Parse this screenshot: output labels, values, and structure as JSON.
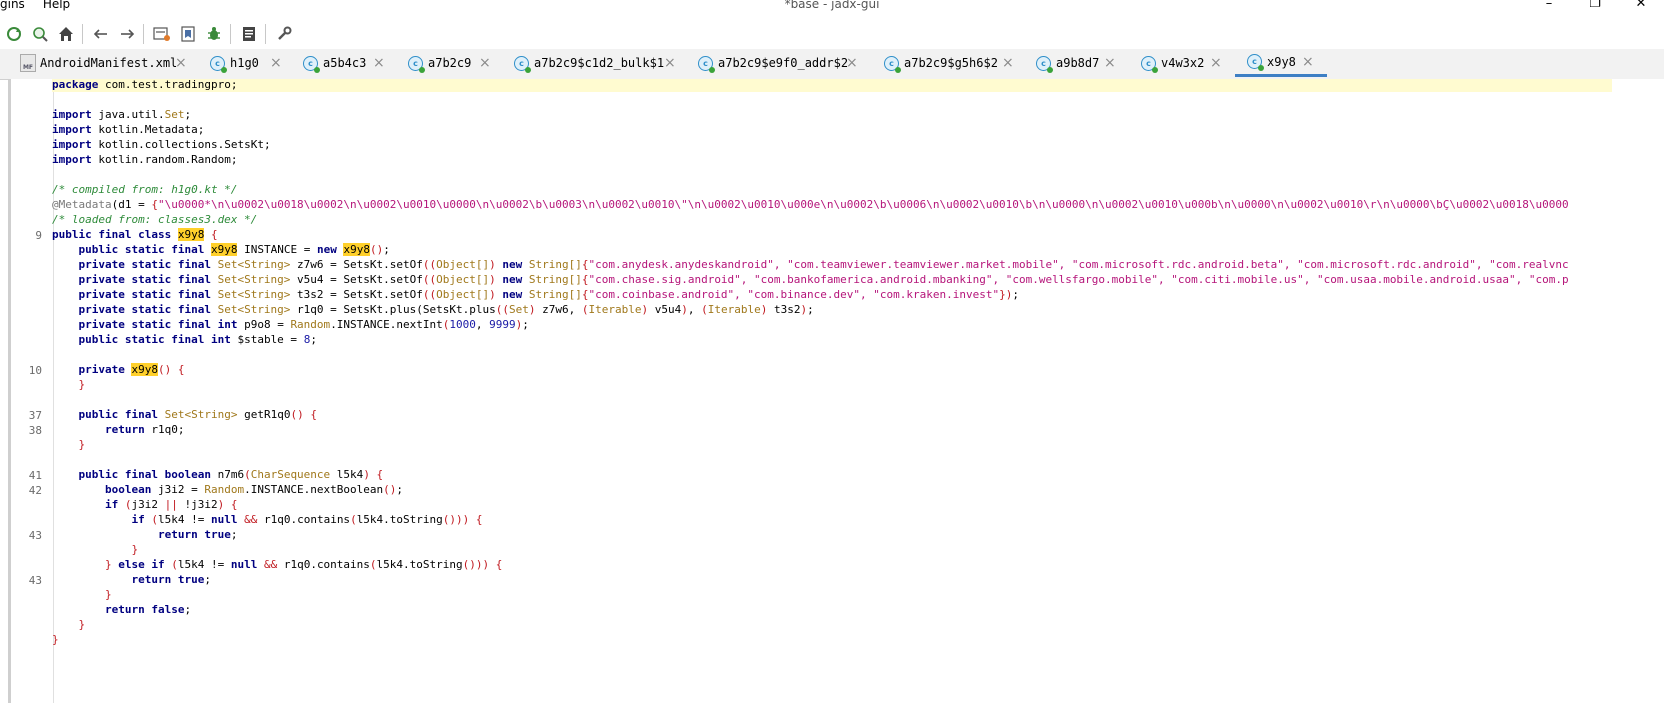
{
  "menu": [
    "gins",
    "Help"
  ],
  "window_title": "*base - jadx-gui",
  "window_controls": [
    "–",
    "❐",
    "✕"
  ],
  "toolbar_icons": [
    "sync-icon",
    "search-icon",
    "home-icon",
    "back-icon",
    "forward-icon",
    "decompile-icon",
    "bookmark-icon",
    "debug-bug-icon",
    "log-icon",
    "preferences-wrench-icon"
  ],
  "tabs": [
    {
      "label": "AndroidManifest.xml",
      "icon": "manifest-file-icon"
    },
    {
      "label": "h1g0",
      "icon": "class-icon"
    },
    {
      "label": "a5b4c3",
      "icon": "class-icon"
    },
    {
      "label": "a7b2c9",
      "icon": "class-icon"
    },
    {
      "label": "a7b2c9$c1d2_bulk$1",
      "icon": "class-icon"
    },
    {
      "label": "a7b2c9$e9f0_addr$2",
      "icon": "class-icon"
    },
    {
      "label": "a7b2c9$g5h6$2",
      "icon": "class-icon"
    },
    {
      "label": "a9b8d7",
      "icon": "class-icon"
    },
    {
      "label": "v4w3x2",
      "icon": "class-icon"
    },
    {
      "label": "x9y8",
      "icon": "class-icon",
      "active": true
    }
  ],
  "gutter_numbers": [
    "9",
    "10",
    "37",
    "38",
    "41",
    "42",
    "43",
    "43"
  ],
  "code": {
    "pkg": "com.test.tradingpro",
    "imp_set_pkg": "java.util.",
    "imp_set": "Set",
    "imp_meta": "kotlin.Metadata",
    "imp_setskt": "kotlin.collections.SetsKt",
    "imp_random": "kotlin.random.Random",
    "comment_compiled": "/* compiled from: h1g0.kt */",
    "metadata_prefix": "@Metadata",
    "metadata_d1_name": "d1",
    "metadata_value": "\"\\u0000*\\n\\u0002\\u0018\\u0002\\n\\u0002\\u0010\\u0000\\n\\u0002\\b\\u0003\\n\\u0002\\u0010\\\"\\n\\u0002\\u0010\\u000e\\n\\u0002\\b\\u0006\\n\\u0002\\u0010\\b\\n\\u0000\\n\\u0002\\u0010\\u000b\\n\\u0000\\n\\u0002\\u0010\\r\\n\\u0000\\bÇ\\u0002\\u0018\\u0000",
    "comment_loaded": "/* loaded from: classes3.dex */",
    "class_name": "x9y8",
    "z7w6_list": "\"com.anydesk.anydeskandroid\", \"com.teamviewer.teamviewer.market.mobile\", \"com.microsoft.rdc.android.beta\", \"com.microsoft.rdc.android\", \"com.realvnc",
    "v5u4_list": "\"com.chase.sig.android\", \"com.bankofamerica.android.mbanking\", \"com.wellsfargo.mobile\", \"com.citi.mobile.us\", \"com.usaa.mobile.android.usaa\", \"com.p",
    "t3s2_list": "\"com.coinbase.android\", \"com.binance.dev\", \"com.kraken.invest\"",
    "rand_min": "1000",
    "rand_max": "9999",
    "stable_val": "8"
  }
}
